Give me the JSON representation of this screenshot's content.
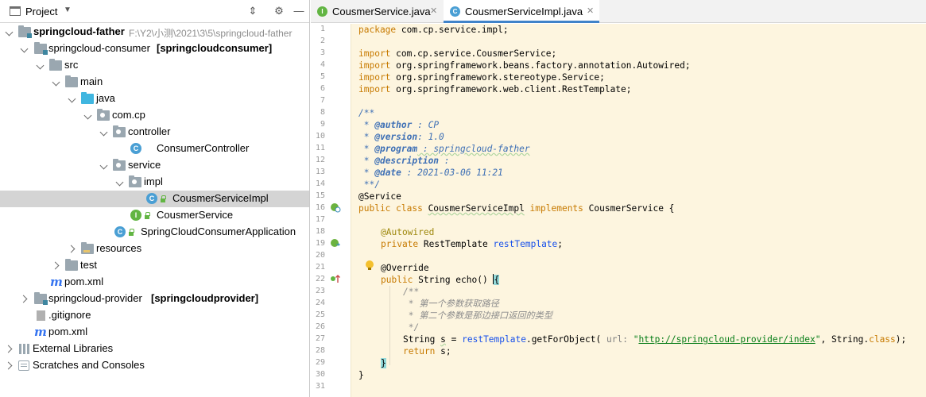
{
  "project_panel": {
    "title": "Project",
    "tree": [
      {
        "label": "springcloud-father",
        "path": "F:\\Y2\\小测\\2021\\3\\5\\springcloud-father"
      },
      {
        "label": "springcloud-consumer",
        "module": "[springcloudconsumer]"
      },
      {
        "label": "src"
      },
      {
        "label": "main"
      },
      {
        "label": "java"
      },
      {
        "label": "com.cp"
      },
      {
        "label": "controller"
      },
      {
        "label": "ConsumerController"
      },
      {
        "label": "service"
      },
      {
        "label": "impl"
      },
      {
        "label": "CousmerServiceImpl"
      },
      {
        "label": "CousmerService"
      },
      {
        "label": "SpringCloudConsumerApplication"
      },
      {
        "label": "resources"
      },
      {
        "label": "test"
      },
      {
        "label": "pom.xml"
      },
      {
        "label": "springcloud-provider",
        "module": "[springcloudprovider]"
      },
      {
        "label": ".gitignore"
      },
      {
        "label": "pom.xml"
      },
      {
        "label": "External Libraries"
      },
      {
        "label": "Scratches and Consoles"
      }
    ]
  },
  "tabs": [
    {
      "label": "CousmerService.java",
      "icon": "I"
    },
    {
      "label": "CousmerServiceImpl.java",
      "icon": "C"
    }
  ],
  "code": {
    "line_numbers": [
      "1",
      "2",
      "3",
      "4",
      "5",
      "6",
      "7",
      "8",
      "9",
      "10",
      "11",
      "12",
      "13",
      "14",
      "15",
      "16",
      "17",
      "18",
      "19",
      "20",
      "21",
      "22",
      "23",
      "24",
      "25",
      "26",
      "27",
      "28",
      "29",
      "30",
      "31"
    ],
    "l1_kw": "package",
    "l1_rest": " com.cp.service.impl;",
    "l3_kw": "import",
    "l3_rest": " com.cp.service.CousmerService;",
    "l4_kw": "import",
    "l4_rest": " org.springframework.beans.factory.annotation.Autowired;",
    "l5_kw": "import",
    "l5_rest": " org.springframework.stereotype.Service;",
    "l6_kw": "import",
    "l6_rest": " org.springframework.web.client.RestTemplate;",
    "l8": "/**",
    "l9_star": " * ",
    "l9_tag": "@author",
    "l9_val": " : CP",
    "l10_star": " * ",
    "l10_tag": "@version",
    "l10_val": ": 1.0",
    "l11_star": " * ",
    "l11_tag": "@program",
    "l11_val": " : springcloud-father",
    "l12_star": " * ",
    "l12_tag": "@description",
    "l12_val": " :",
    "l13_star": " * ",
    "l13_tag": "@date",
    "l13_val": " : 2021-03-06 11:21",
    "l14": " **/",
    "l15": "@Service",
    "l16_kw1": "public class ",
    "l16_name": "CousmerServiceImpl",
    "l16_kw2": " implements ",
    "l16_rest": "CousmerService {",
    "l18": "@Autowired",
    "l19_kw": "private ",
    "l19_type": "RestTemplate ",
    "l19_var": "restTemplate",
    "l19_end": ";",
    "l21": "@Override",
    "l22_kw": "public ",
    "l22_rest": "String echo() ",
    "l22_brace": "{",
    "l23": "/**",
    "l24": " * 第一个参数获取路径",
    "l25": " * 第二个参数是那边接口返回的类型",
    "l26": " */",
    "l27_a": "String ",
    "l27_s": "s",
    "l27_b": " = ",
    "l27_var": "restTemplate",
    "l27_c": ".getForObject( ",
    "l27_hint": "url: ",
    "l27_q1": "\"",
    "l27_url": "http://springcloud-provider/index",
    "l27_q2": "\"",
    "l27_d": ", String.",
    "l27_kw": "class",
    "l27_e": ");",
    "l28_kw": "return ",
    "l28_rest": "s;",
    "l29": "}",
    "l30": "}"
  },
  "colors": {
    "editor_background": "#fdf5df",
    "selection": "#d4d4d4",
    "active_tab_underline": "#4083c9",
    "keyword": "#0033b3",
    "annotation": "#9e880d",
    "string": "#067d17"
  }
}
